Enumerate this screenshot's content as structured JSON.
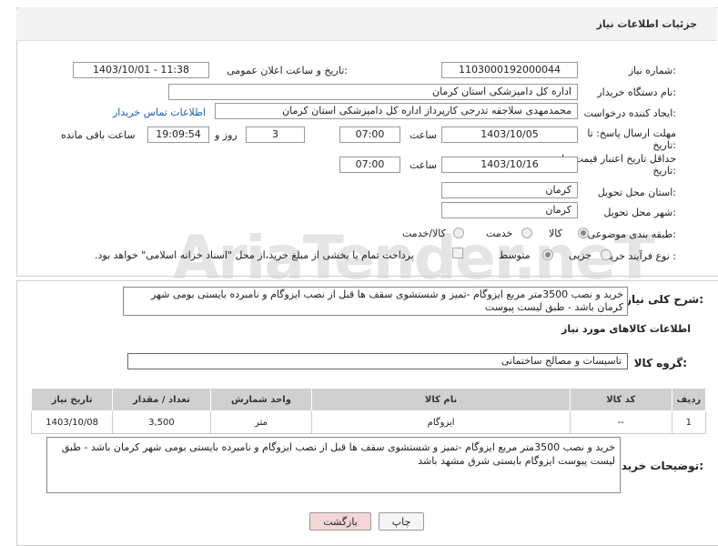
{
  "page": {
    "title": "جزئیات اطلاعات نیاز"
  },
  "watermark": {
    "text": "AriaTender.neT"
  },
  "fields": {
    "need_number_label": "شماره نیاز:",
    "need_number": "1103000192000044",
    "announce_label": "تاریخ و ساعت اعلان عمومی:",
    "announce_value": "1403/10/01 - 11:38",
    "buyer_org_label": "نام دستگاه خریدار:",
    "buyer_org": "اداره کل دامپزشکی استان کرمان",
    "creator_label": "ایجاد کننده درخواست:",
    "creator": "محمدمهدی سلاجقه تدرجی کارپرداز اداره کل دامپزشکی استان کرمان",
    "contact_link": "اطلاعات تماس خریدار",
    "deadline_label_1": "مهلت ارسال پاسخ: تا",
    "deadline_label_2": "تاریخ:",
    "deadline_date": "1403/10/05",
    "time_label": "ساعت",
    "deadline_time": "07:00",
    "days_value": "3",
    "days_label": "روز و",
    "remain_time": "19:09:54",
    "remain_label": "ساعت باقی مانده",
    "validity_label_1": "حداقل تاریخ اعتبار قیمت: تا",
    "validity_label_2": "تاریخ:",
    "validity_date": "1403/10/16",
    "validity_time": "07:00",
    "province_label": "استان محل تحویل:",
    "province": "کرمان",
    "city_label": "شهر محل تحویل:",
    "city": "کرمان",
    "category_label": "طبقه بندی موضوعی:",
    "category_options": [
      "کالا",
      "خدمت"
    ],
    "category_combined": "کالا/خدمت",
    "process_label": "نوع فرآیند خرید :",
    "process_options": [
      "جزیی",
      "متوسط"
    ],
    "payment_note": "پرداخت تمام یا بخشی از مبلغ خرید،از محل \"اسناد خزانه اسلامی\" خواهد بود."
  },
  "summary": {
    "label": "شرح کلی نیاز:",
    "text": "خرید و نصب 3500متر مربع ایزوگام -تمیز و شستشوی سقف ها قبل از نصب ایزوگام و نامبرده بایستی بومی شهر کرمان باشد - طبق لیست پیوست"
  },
  "goods_section": {
    "title": "اطلاعات کالاهای مورد نیاز",
    "group_label": "گروه کالا:",
    "group_value": "تاسیسات و مصالح ساختمانی"
  },
  "table": {
    "headers": [
      "ردیف",
      "کد کالا",
      "نام کالا",
      "واحد شمارش",
      "تعداد / مقدار",
      "تاریخ نیاز"
    ],
    "rows": [
      [
        "1",
        "--",
        "ایزوگام",
        "متر",
        "3,500",
        "1403/10/08"
      ]
    ]
  },
  "buyer_notes": {
    "label": "توضیحات خریدار:",
    "text": "خرید و نصب 3500متر مربع ایزوگام -تمیز و شستشوی سقف ها قبل از نصب ایزوگام و نامبرده بایستی بومی شهر کرمان باشد - طبق لیست پیوست ایزوگام بایستی شرق مشهد باشد"
  },
  "buttons": {
    "print": "چاپ",
    "back": "بازگشت"
  },
  "colors": {
    "back_button_bg": "#f4d6d6",
    "print_button_bg": "#f5f5f5",
    "link": "#1a5fb4"
  }
}
